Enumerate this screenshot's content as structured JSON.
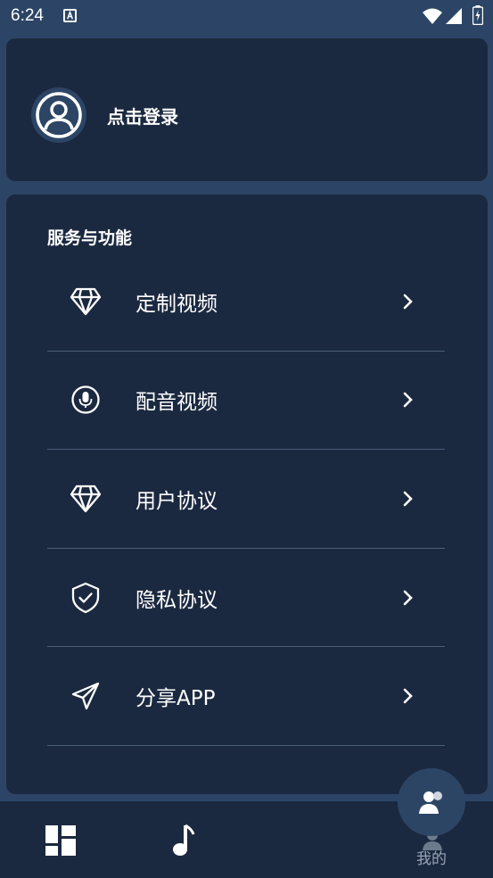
{
  "status_bar": {
    "time": "6:24",
    "icons": [
      "a-notification-icon",
      "wifi-icon",
      "signal-icon",
      "battery-icon"
    ]
  },
  "profile": {
    "avatar_icon": "user-circle-icon",
    "login_label": "点击登录"
  },
  "services": {
    "title": "服务与功能",
    "items": [
      {
        "label": "定制视频",
        "icon": "diamond-icon"
      },
      {
        "label": "配音视频",
        "icon": "microphone-icon"
      },
      {
        "label": "用户协议",
        "icon": "diamond-icon"
      },
      {
        "label": "隐私协议",
        "icon": "shield-check-icon"
      },
      {
        "label": "分享APP",
        "icon": "send-icon"
      }
    ]
  },
  "bottom_nav": {
    "items": [
      {
        "icon": "grid-icon"
      },
      {
        "icon": "music-note-icon"
      },
      {
        "icon": "user-icon",
        "label": "我的"
      }
    ]
  },
  "fab": {
    "icon": "users-icon"
  },
  "colors": {
    "background": "#2c4566",
    "card": "#1b2940",
    "divider": "#4b5e78",
    "text": "#ffffff"
  }
}
